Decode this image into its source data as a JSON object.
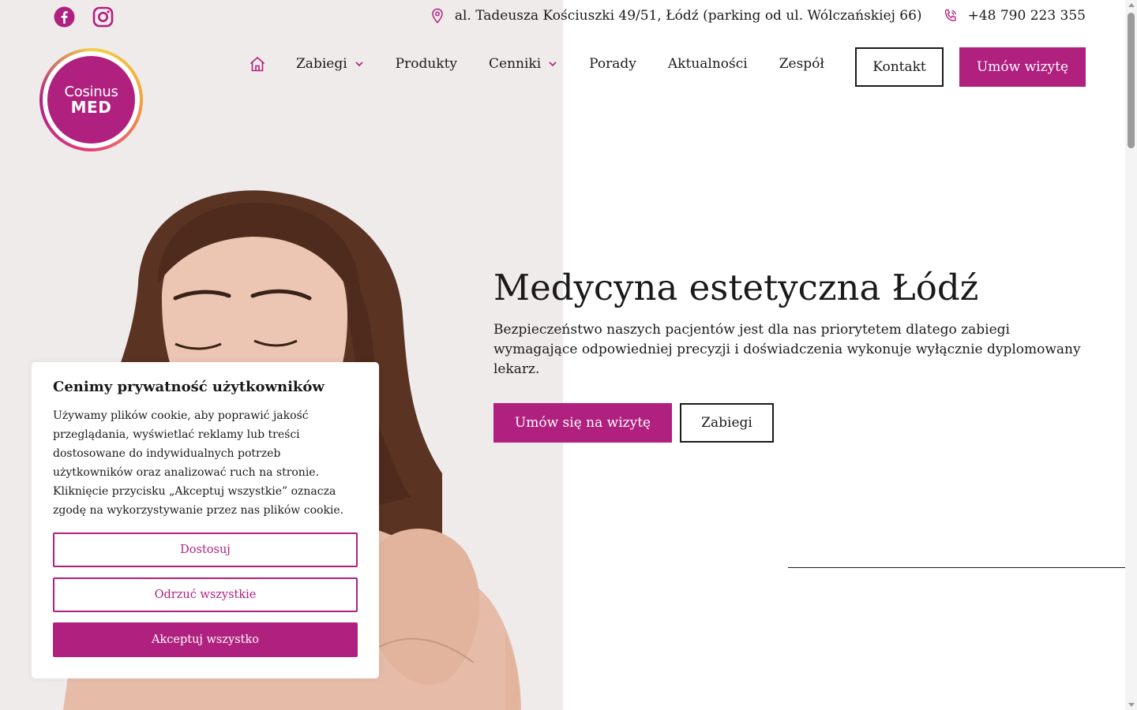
{
  "colors": {
    "accent": "#b0207e",
    "left_panel": "#efebeb",
    "text": "#1a1a1a"
  },
  "topbar": {
    "social": [
      {
        "icon": "facebook-icon"
      },
      {
        "icon": "instagram-icon"
      }
    ],
    "address": "al. Tadeusza Kościuszki 49/51, Łódź (parking od ul. Wólczańskiej 66)",
    "phone": "+48 790 223 355"
  },
  "logo": {
    "line1": "Cosinus",
    "line2": "MED"
  },
  "nav": {
    "items": [
      {
        "label": "Zabiegi",
        "dropdown": true
      },
      {
        "label": "Produkty",
        "dropdown": false
      },
      {
        "label": "Cenniki",
        "dropdown": true
      },
      {
        "label": "Porady",
        "dropdown": false
      },
      {
        "label": "Aktualności",
        "dropdown": false
      },
      {
        "label": "Zespół",
        "dropdown": false
      }
    ],
    "kontakt": "Kontakt",
    "umow": "Umów wizytę"
  },
  "hero": {
    "title": "Medycyna estetyczna Łódź",
    "text": "Bezpieczeństwo naszych pacjentów jest dla nas priorytetem dlatego zabiegi wymagające odpowiedniej precyzji i doświadczenia wykonuje wyłącznie dyplomowany lekarz.",
    "cta_primary": "Umów się na wizytę",
    "cta_secondary": "Zabiegi"
  },
  "cookie": {
    "title": "Cenimy prywatność użytkowników",
    "text": "Używamy plików cookie, aby poprawić jakość przeglądania, wyświetlać reklamy lub treści dostosowane do indywidualnych potrzeb użytkowników oraz analizować ruch na stronie. Kliknięcie przycisku „Akceptuj wszystkie” oznacza zgodę na wykorzystywanie przez nas plików cookie.",
    "customize": "Dostosuj",
    "reject": "Odrzuć wszystkie",
    "accept": "Akceptuj wszystko"
  }
}
